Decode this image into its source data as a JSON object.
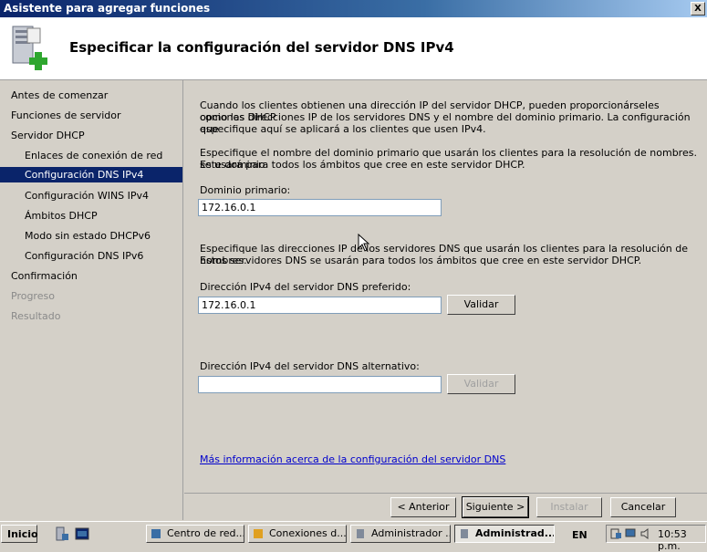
{
  "window": {
    "title": "Asistente para agregar funciones",
    "close_label": "X"
  },
  "header": {
    "title": "Especificar la configuración del servidor DNS IPv4",
    "icon": "server-add-icon"
  },
  "sidebar": {
    "items": [
      {
        "label": "Antes de comenzar"
      },
      {
        "label": "Funciones de servidor"
      },
      {
        "label": "Servidor DHCP"
      },
      {
        "label": "Enlaces de conexión de red"
      },
      {
        "label": "Configuración DNS IPv4"
      },
      {
        "label": "Configuración WINS IPv4"
      },
      {
        "label": "Ámbitos DHCP"
      },
      {
        "label": "Modo sin estado DHCPv6"
      },
      {
        "label": "Configuración DNS IPv6"
      },
      {
        "label": "Confirmación"
      },
      {
        "label": "Progreso"
      },
      {
        "label": "Resultado"
      }
    ]
  },
  "main": {
    "intro_line1": "Cuando los clientes obtienen una dirección IP del servidor DHCP, pueden proporcionárseles opciones DHCP",
    "intro_line2": "como las direcciones IP de los servidores DNS y el nombre del dominio primario. La configuración que",
    "intro_line3": "especifique aquí se aplicará a los clientes que usen IPv4.",
    "domain_desc_line1": "Especifique el nombre del dominio primario que usarán los clientes para la resolución de nombres. Este dominio",
    "domain_desc_line2": "se usará para todos los ámbitos que cree en este servidor DHCP.",
    "domain_label": "Dominio primario:",
    "domain_value": "172.16.0.1",
    "dns_desc_line1": "Especifique las direcciones IP de los servidores DNS que usarán los clientes para la resolución de nombres.",
    "dns_desc_line2": "Estos servidores DNS se usarán para todos los ámbitos que cree en este servidor DHCP.",
    "preferred_label": "Dirección IPv4 del servidor DNS preferido:",
    "preferred_value": "172.16.0.1",
    "validate_label": "Validar",
    "alternate_label": "Dirección IPv4 del servidor DNS alternativo:",
    "alternate_value": "",
    "validate2_label": "Validar",
    "more_info_link": "Más información acerca de la configuración del servidor DNS"
  },
  "buttons": {
    "back": "< Anterior",
    "next": "Siguiente >",
    "install": "Instalar",
    "cancel": "Cancelar"
  },
  "taskbar": {
    "start": "Inicio",
    "tasks": [
      {
        "label": "Centro de red..."
      },
      {
        "label": "Conexiones d..."
      },
      {
        "label": "Administrador ..."
      },
      {
        "label": "Administrad..."
      }
    ],
    "language": "EN",
    "clock": "10:53 p.m."
  }
}
